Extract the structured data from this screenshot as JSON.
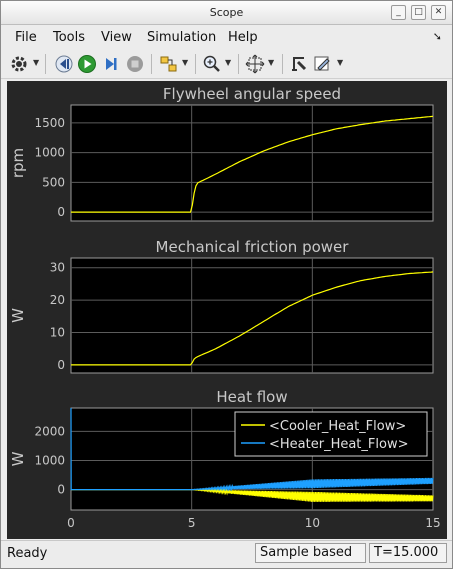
{
  "window": {
    "title": "Scope"
  },
  "menu": {
    "items": [
      "File",
      "Tools",
      "View",
      "Simulation",
      "Help"
    ]
  },
  "toolbar": {
    "icons": [
      "gear-icon",
      "step-back-icon",
      "run-icon",
      "step-forward-icon",
      "stop-icon",
      "highlight-block-icon",
      "zoom-icon",
      "fit-to-view-icon",
      "cursor-measure-icon",
      "edit-style-icon"
    ]
  },
  "status": {
    "left": "Ready",
    "mode": "Sample based",
    "time": "T=15.000"
  },
  "colors": {
    "background": "#262626",
    "axes": "#000000",
    "grid": "#5c5c5c",
    "text": "#c8c8c8",
    "yellow": "#ffff00",
    "blue": "#1ea0ff"
  },
  "chart_data": [
    {
      "type": "line",
      "title": "Flywheel angular speed",
      "ylabel": "rpm",
      "xlim": [
        0,
        15
      ],
      "ylim": [
        -150,
        1800
      ],
      "yticks": [
        0,
        500,
        1000,
        1500
      ],
      "grid": true,
      "series": [
        {
          "color": "#ffff00",
          "x": [
            0,
            5,
            5.05,
            5.2,
            6,
            7,
            8,
            9,
            10,
            11,
            12,
            13,
            14,
            15
          ],
          "values": [
            0,
            0,
            230,
            480,
            640,
            850,
            1030,
            1180,
            1300,
            1400,
            1470,
            1530,
            1570,
            1610
          ]
        }
      ]
    },
    {
      "type": "line",
      "title": "Mechanical friction power",
      "ylabel": "W",
      "xlim": [
        0,
        15
      ],
      "ylim": [
        -2.5,
        33
      ],
      "yticks": [
        0,
        10,
        20,
        30
      ],
      "grid": true,
      "series": [
        {
          "color": "#ffff00",
          "x": [
            0,
            5,
            5.05,
            5.2,
            6,
            7,
            8,
            9,
            10,
            11,
            12,
            13,
            14,
            15
          ],
          "values": [
            0,
            0,
            1.5,
            2.4,
            5,
            9,
            13.5,
            18,
            21.5,
            24,
            26,
            27.3,
            28.2,
            28.7
          ]
        }
      ]
    },
    {
      "type": "line",
      "title": "Heat flow",
      "ylabel": "W",
      "xlim": [
        0,
        15
      ],
      "xticks": [
        0,
        5,
        10,
        15
      ],
      "ylim": [
        -700,
        2800
      ],
      "yticks": [
        0,
        1000,
        2000
      ],
      "grid": true,
      "legend_position": "top-right",
      "series": [
        {
          "name": "<Cooler_Heat_Flow>",
          "color": "#ffff00",
          "x": [
            0,
            5,
            10,
            15
          ],
          "values": [
            0,
            0,
            -250,
            -300
          ],
          "oscillation_amplitude": [
            0,
            0,
            170,
            100
          ]
        },
        {
          "name": "<Heater_Heat_Flow>",
          "color": "#1ea0ff",
          "x": [
            0,
            5,
            10,
            15
          ],
          "values": [
            0,
            0,
            200,
            300
          ],
          "oscillation_amplitude": [
            0,
            0,
            150,
            100
          ],
          "initial_spike": 2800
        }
      ]
    }
  ]
}
